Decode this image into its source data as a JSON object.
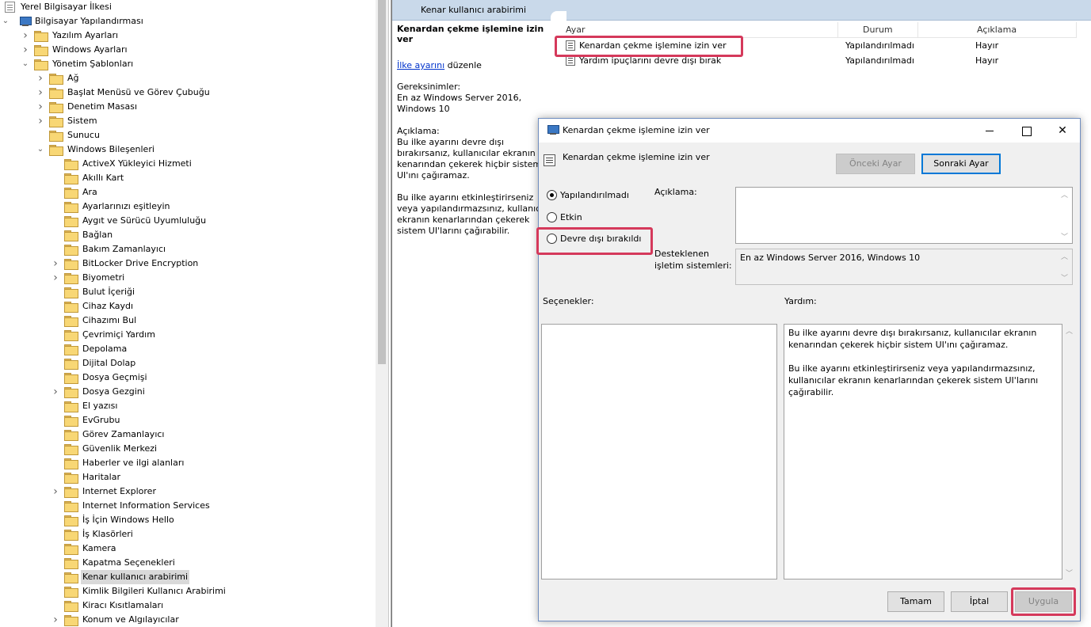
{
  "tree": {
    "items": [
      {
        "label": "Yerel Bilgisayar İlkesi",
        "depth": 0,
        "icon": "policy-doc-icon",
        "expander": ""
      },
      {
        "label": "Bilgisayar Yapılandırması",
        "depth": 0,
        "icon": "computer-icon",
        "expander": "down"
      },
      {
        "label": "Yazılım Ayarları",
        "depth": 1,
        "icon": "folder-icon",
        "expander": "right"
      },
      {
        "label": "Windows Ayarları",
        "depth": 1,
        "icon": "folder-icon",
        "expander": "right"
      },
      {
        "label": "Yönetim Şablonları",
        "depth": 1,
        "icon": "folder-icon",
        "expander": "down"
      },
      {
        "label": "Ağ",
        "depth": 2,
        "icon": "folder-icon",
        "expander": "right"
      },
      {
        "label": "Başlat Menüsü ve Görev Çubuğu",
        "depth": 2,
        "icon": "folder-icon",
        "expander": "right"
      },
      {
        "label": "Denetim Masası",
        "depth": 2,
        "icon": "folder-icon",
        "expander": "right"
      },
      {
        "label": "Sistem",
        "depth": 2,
        "icon": "folder-icon",
        "expander": "right"
      },
      {
        "label": "Sunucu",
        "depth": 2,
        "icon": "folder-icon",
        "expander": ""
      },
      {
        "label": "Windows Bileşenleri",
        "depth": 2,
        "icon": "folder-icon",
        "expander": "down"
      },
      {
        "label": "ActiveX Yükleyici Hizmeti",
        "depth": 3,
        "icon": "folder-icon",
        "expander": ""
      },
      {
        "label": "Akıllı Kart",
        "depth": 3,
        "icon": "folder-icon",
        "expander": ""
      },
      {
        "label": "Ara",
        "depth": 3,
        "icon": "folder-icon",
        "expander": ""
      },
      {
        "label": "Ayarlarınızı eşitleyin",
        "depth": 3,
        "icon": "folder-icon",
        "expander": ""
      },
      {
        "label": "Aygıt ve Sürücü Uyumluluğu",
        "depth": 3,
        "icon": "folder-icon",
        "expander": ""
      },
      {
        "label": "Bağlan",
        "depth": 3,
        "icon": "folder-icon",
        "expander": ""
      },
      {
        "label": "Bakım Zamanlayıcı",
        "depth": 3,
        "icon": "folder-icon",
        "expander": ""
      },
      {
        "label": "BitLocker Drive Encryption",
        "depth": 3,
        "icon": "folder-icon",
        "expander": "right"
      },
      {
        "label": "Biyometri",
        "depth": 3,
        "icon": "folder-icon",
        "expander": "right"
      },
      {
        "label": "Bulut İçeriği",
        "depth": 3,
        "icon": "folder-icon",
        "expander": ""
      },
      {
        "label": "Cihaz Kaydı",
        "depth": 3,
        "icon": "folder-icon",
        "expander": ""
      },
      {
        "label": "Cihazımı Bul",
        "depth": 3,
        "icon": "folder-icon",
        "expander": ""
      },
      {
        "label": "Çevrimiçi Yardım",
        "depth": 3,
        "icon": "folder-icon",
        "expander": ""
      },
      {
        "label": "Depolama",
        "depth": 3,
        "icon": "folder-icon",
        "expander": ""
      },
      {
        "label": "Dijital Dolap",
        "depth": 3,
        "icon": "folder-icon",
        "expander": ""
      },
      {
        "label": "Dosya Geçmişi",
        "depth": 3,
        "icon": "folder-icon",
        "expander": ""
      },
      {
        "label": "Dosya Gezgini",
        "depth": 3,
        "icon": "folder-icon",
        "expander": "right"
      },
      {
        "label": "El yazısı",
        "depth": 3,
        "icon": "folder-icon",
        "expander": ""
      },
      {
        "label": "EvGrubu",
        "depth": 3,
        "icon": "folder-icon",
        "expander": ""
      },
      {
        "label": "Görev Zamanlayıcı",
        "depth": 3,
        "icon": "folder-icon",
        "expander": ""
      },
      {
        "label": "Güvenlik Merkezi",
        "depth": 3,
        "icon": "folder-icon",
        "expander": ""
      },
      {
        "label": "Haberler ve ilgi alanları",
        "depth": 3,
        "icon": "folder-icon",
        "expander": ""
      },
      {
        "label": "Haritalar",
        "depth": 3,
        "icon": "folder-icon",
        "expander": ""
      },
      {
        "label": "Internet Explorer",
        "depth": 3,
        "icon": "folder-icon",
        "expander": "right"
      },
      {
        "label": "Internet Information Services",
        "depth": 3,
        "icon": "folder-icon",
        "expander": ""
      },
      {
        "label": "İş İçin Windows Hello",
        "depth": 3,
        "icon": "folder-icon",
        "expander": ""
      },
      {
        "label": "İş Klasörleri",
        "depth": 3,
        "icon": "folder-icon",
        "expander": ""
      },
      {
        "label": "Kamera",
        "depth": 3,
        "icon": "folder-icon",
        "expander": ""
      },
      {
        "label": "Kapatma Seçenekleri",
        "depth": 3,
        "icon": "folder-icon",
        "expander": ""
      },
      {
        "label": "Kenar kullanıcı arabirimi",
        "depth": 3,
        "icon": "folder-icon",
        "expander": "",
        "selected": true
      },
      {
        "label": "Kimlik Bilgileri Kullanıcı Arabirimi",
        "depth": 3,
        "icon": "folder-icon",
        "expander": ""
      },
      {
        "label": "Kiracı Kısıtlamaları",
        "depth": 3,
        "icon": "folder-icon",
        "expander": ""
      },
      {
        "label": "Konum ve Algılayıcılar",
        "depth": 3,
        "icon": "folder-icon",
        "expander": "right"
      }
    ]
  },
  "right": {
    "header_title": "Kenar kullanıcı arabirimi",
    "desc": {
      "setting_title": "Kenardan çekme işlemine izin ver",
      "edit_link": "İlke ayarını",
      "edit_suffix": " düzenle",
      "requirements_label": "Gereksinimler:",
      "requirements_text": "En az Windows Server 2016, Windows 10",
      "description_label": "Açıklama:",
      "description_p1": "Bu ilke ayarını devre dışı bırakırsanız, kullanıcılar ekranın kenarından çekerek hiçbir sistem UI'ını çağıramaz.",
      "description_p2": "Bu ilke ayarını etkinleştirirseniz veya yapılandırmazsınız, kullanıcılar ekranın kenarlarından çekerek sistem UI'larını çağırabilir."
    },
    "table": {
      "headers": {
        "setting": "Ayar",
        "state": "Durum",
        "comment": "Açıklama"
      },
      "rows": [
        {
          "setting": "Kenardan çekme işlemine izin ver",
          "state": "Yapılandırılmadı",
          "comment": "Hayır"
        },
        {
          "setting": "Yardım ipuçlarını devre dışı bırak",
          "state": "Yapılandırılmadı",
          "comment": "Hayır"
        }
      ]
    }
  },
  "dialog": {
    "title": "Kenardan çekme işlemine izin ver",
    "policy_name": "Kenardan çekme işlemine izin ver",
    "prev_button": "Önceki Ayar",
    "next_button": "Sonraki Ayar",
    "radio_not_configured": "Yapılandırılmadı",
    "radio_enabled": "Etkin",
    "radio_disabled": "Devre dışı bırakıldı",
    "comment_label": "Açıklama:",
    "supported_label_line1": "Desteklenen",
    "supported_label_line2": "işletim sistemleri:",
    "supported_value": "En az Windows Server 2016, Windows 10",
    "options_label": "Seçenekler:",
    "help_label": "Yardım:",
    "help_p1": "Bu ilke ayarını devre dışı bırakırsanız, kullanıcılar ekranın kenarından çekerek hiçbir sistem UI'ını çağıramaz.",
    "help_p2": "Bu ilke ayarını etkinleştirirseniz veya yapılandırmazsınız, kullanıcılar ekranın kenarlarından çekerek sistem UI'larını çağırabilir.",
    "ok_button": "Tamam",
    "cancel_button": "İptal",
    "apply_button": "Uygula",
    "selected_option": "Yapılandırılmadı"
  },
  "colors": {
    "highlight": "#d5395b",
    "header_bg": "#c9d9ea",
    "link": "#0033cc",
    "focus": "#0078d7"
  }
}
